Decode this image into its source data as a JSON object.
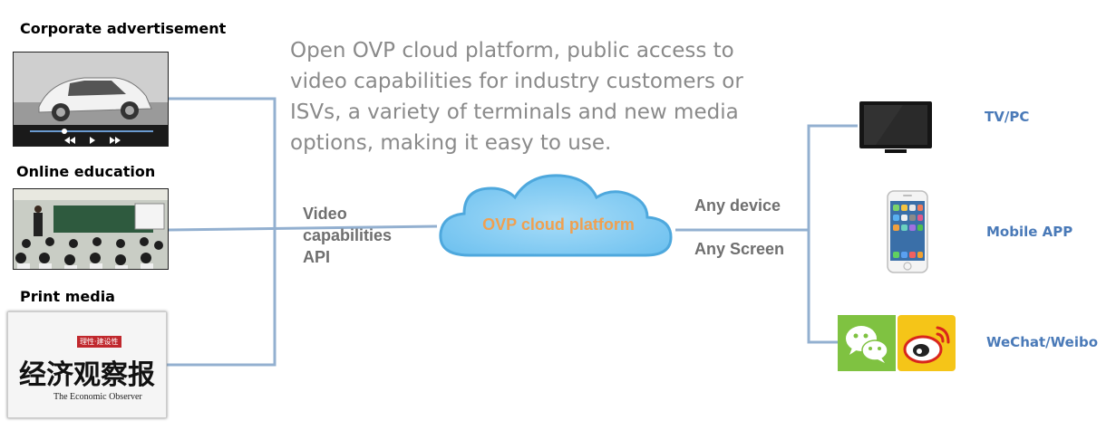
{
  "intro": "Open OVP cloud platform, public access to video capabilities for industry customers or ISVs, a variety of terminals and new media options, making it easy to use.",
  "sources": [
    {
      "label": "Corporate advertisement"
    },
    {
      "label": "Online education"
    },
    {
      "label": "Print media",
      "masthead": "经济观察报",
      "masthead_en": "The Economic Observer",
      "tag": "理性·建设性"
    }
  ],
  "api_label": [
    "Video",
    "capabilities",
    "API"
  ],
  "cloud": {
    "label": "OVP cloud platform"
  },
  "device_labels": [
    "Any device",
    "Any Screen"
  ],
  "destinations": [
    {
      "label": "TV/PC"
    },
    {
      "label": "Mobile APP"
    },
    {
      "label": "WeChat/Weibo"
    }
  ],
  "colors": {
    "connector": "#93b0d0",
    "cloud_fill": "#7ec8f2",
    "cloud_stroke": "#5aaee0",
    "cloud_text": "#f0a050",
    "dest_text": "#4a7ab8",
    "intro_text": "#8a8a8a"
  }
}
